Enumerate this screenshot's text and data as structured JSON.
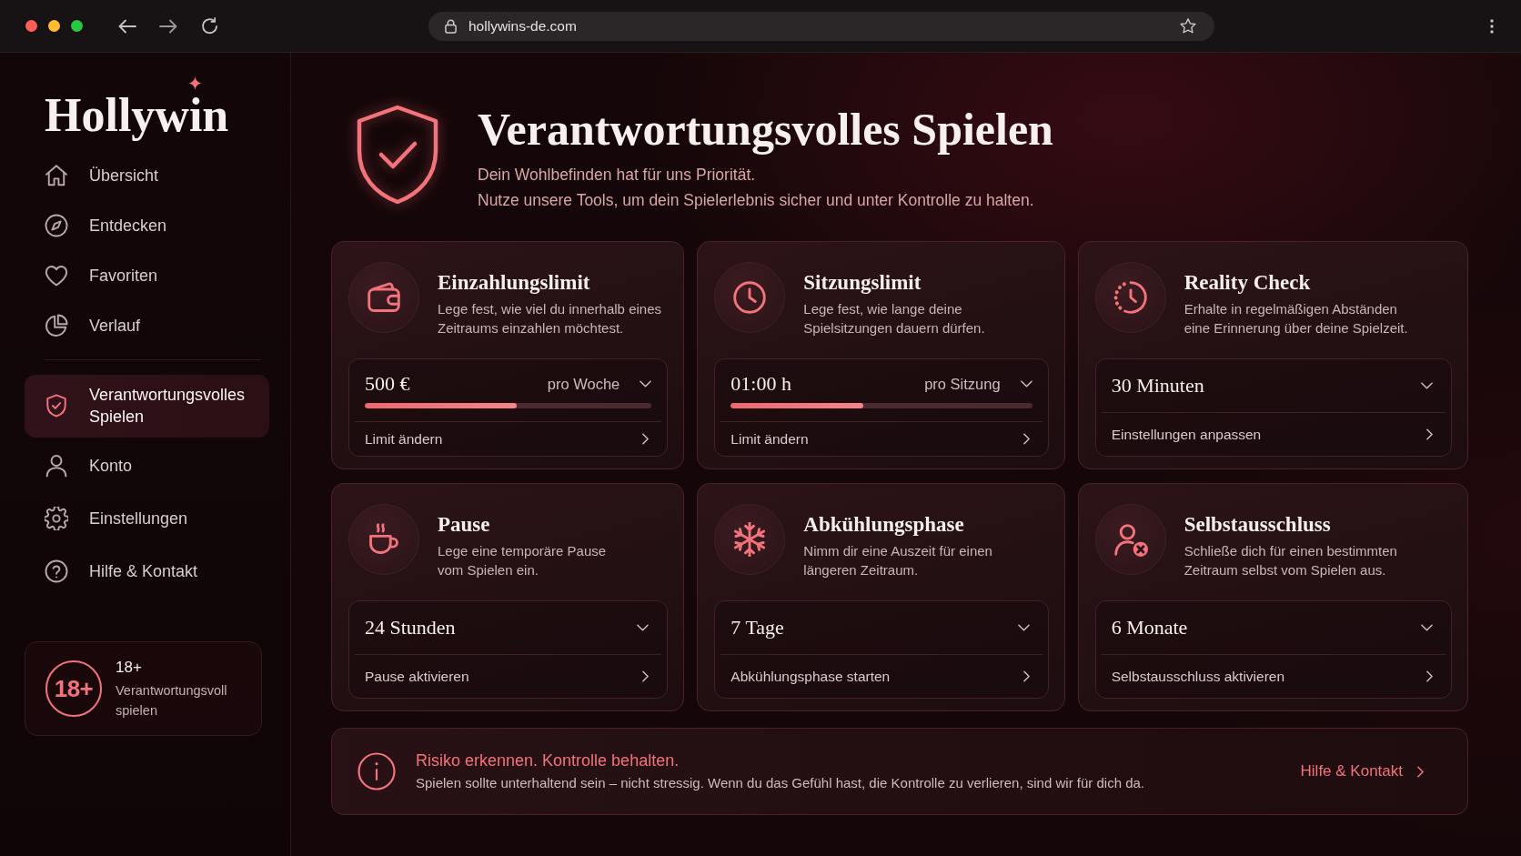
{
  "browser": {
    "url": "hollywins-de.com"
  },
  "sidebar": {
    "logo": "Hollywin",
    "sections": [
      {
        "items": [
          {
            "label": "Übersicht",
            "selected": false
          },
          {
            "label": "Entdecken",
            "selected": false
          },
          {
            "label": "Favoriten",
            "selected": false
          },
          {
            "label": "Verlauf",
            "selected": false
          }
        ]
      },
      {
        "items": [
          {
            "label": "Verantwortungsvolles Spielen",
            "selected": true
          },
          {
            "label": "Konto",
            "selected": false
          },
          {
            "label": "Einstellungen",
            "selected": false
          },
          {
            "label": "Hilfe & Kontakt",
            "selected": false
          }
        ]
      }
    ],
    "age_notice": {
      "badge": "18+",
      "title": "18+",
      "text": "Verantwortungsvoll\nspielen"
    }
  },
  "header": {
    "title": "Verantwortungsvolles Spielen",
    "subtitle": "Dein Wohlbefinden hat für uns Priorität.\nNutze unsere Tools, um dein Spielerlebnis sicher und unter Kontrolle zu halten."
  },
  "cards": [
    {
      "kind": "limit",
      "title": "Einzahlungslimit",
      "description": "Lege fest, wie viel du innerhalb eines\nZeitraums einzahlen möchtest.",
      "value": "500 €",
      "period": "pro Woche",
      "level": 0.53,
      "action": "Limit ändern"
    },
    {
      "kind": "limit",
      "title": "Sitzungslimit",
      "description": "Lege fest, wie lange deine\nSpielsitzungen dauern dürfen.",
      "value": "01:00 h",
      "period": "pro Sitzung",
      "level": 0.44,
      "action": "Limit ändern"
    },
    {
      "kind": "select",
      "title": "Reality Check",
      "description": "Erhalte in regelmäßigen Abständen\neine Erinnerung über deine Spielzeit.",
      "value": "30 Minuten",
      "action": "Einstellungen anpassen"
    },
    {
      "kind": "select",
      "title": "Pause",
      "description": "Lege eine temporäre Pause\nvom Spielen ein.",
      "value": "24 Stunden",
      "action": "Pause aktivieren"
    },
    {
      "kind": "select",
      "title": "Abkühlungsphase",
      "description": "Nimm dir eine Auszeit für einen\nlängeren Zeitraum.",
      "value": "7 Tage",
      "action": "Abkühlungsphase starten"
    },
    {
      "kind": "select",
      "title": "Selbstausschluss",
      "description": "Schließe dich für einen bestimmten\nZeitraum selbst vom Spielen aus.",
      "value": "6 Monate",
      "action": "Selbstausschluss aktivieren"
    }
  ],
  "banner": {
    "title": "Risiko erkennen. Kontrolle behalten.",
    "text": "Spielen sollte unterhaltend sein – nicht stressig. Wenn du das Gefühl hast, die Kontrolle zu verlieren, sind wir für dich da.",
    "link": "Hilfe & Kontakt"
  }
}
